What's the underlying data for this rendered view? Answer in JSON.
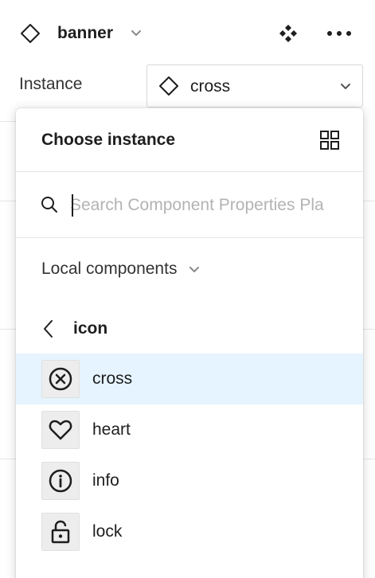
{
  "header": {
    "component_name": "banner",
    "icons": [
      "component-icon",
      "chevron-down-icon",
      "variants-icon",
      "more-icon"
    ]
  },
  "instance_property": {
    "label": "Instance",
    "selected_value": "cross"
  },
  "popover": {
    "title": "Choose instance",
    "search": {
      "placeholder": "Search Component Properties Pla",
      "value": ""
    },
    "library_dropdown": "Local components",
    "folder": "icon",
    "items": [
      {
        "label": "cross",
        "icon": "cross-circle-icon",
        "selected": true
      },
      {
        "label": "heart",
        "icon": "heart-icon",
        "selected": false
      },
      {
        "label": "info",
        "icon": "info-icon",
        "selected": false
      },
      {
        "label": "lock",
        "icon": "lock-icon",
        "selected": false
      }
    ]
  },
  "colors": {
    "selected_row": "#e5f4ff",
    "text": "#1e1e1e",
    "divider": "#e6e6e6",
    "placeholder": "#b3b3b3"
  }
}
